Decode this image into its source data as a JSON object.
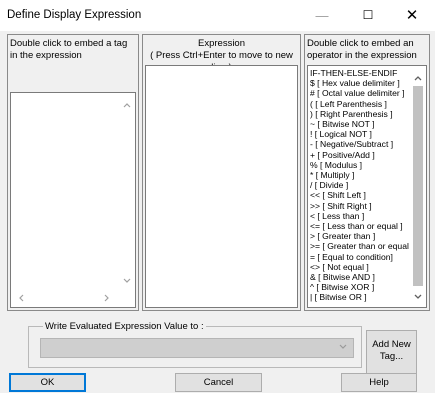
{
  "window": {
    "title": "Define Display Expression",
    "minimize_icon": "—",
    "maximize_icon": "☐",
    "close_icon": "✕"
  },
  "tags_panel": {
    "header": "Double click to embed a tag in the expression",
    "items": []
  },
  "expression_panel": {
    "header_line1": "Expression",
    "header_line2": "( Press Ctrl+Enter to move to new line )",
    "value": ""
  },
  "operators_panel": {
    "header": "Double click to embed an operator in the expression",
    "items": [
      "IF-THEN-ELSE-ENDIF",
      "$ [ Hex value delimiter ]",
      "# [ Octal value delimiter ]",
      "( [ Left Parenthesis ]",
      ") [ Right Parenthesis ]",
      "~ [ Bitwise NOT ]",
      "! [ Logical NOT ]",
      "- [ Negative/Subtract ]",
      "+ [ Positive/Add ]",
      "% [ Modulus ]",
      "* [ Multiply ]",
      "/ [ Divide ]",
      "<< [ Shift Left ]",
      ">> [ Shift Right ]",
      "< [ Less than ]",
      "<= [ Less than or equal ]",
      "> [ Greater than ]",
      ">= [ Greater than or equal ]",
      "= [ Equal to condition]",
      "<> [ Not equal ]",
      "& [ Bitwise AND ]",
      "^ [ Bitwise XOR ]",
      "| [ Bitwise OR ]"
    ]
  },
  "write_group": {
    "label": "Write Evaluated Expression Value to :",
    "selected": ""
  },
  "buttons": {
    "add_new_tag": "Add New Tag...",
    "ok": "OK",
    "cancel": "Cancel",
    "help": "Help"
  },
  "icons": {
    "scroll_up": "chevron-up-icon",
    "scroll_down": "chevron-down-icon",
    "scroll_left": "chevron-left-icon",
    "scroll_right": "chevron-right-icon"
  },
  "colors": {
    "default_button_border": "#0078d7",
    "dialog_background": "#f0f0f0"
  }
}
